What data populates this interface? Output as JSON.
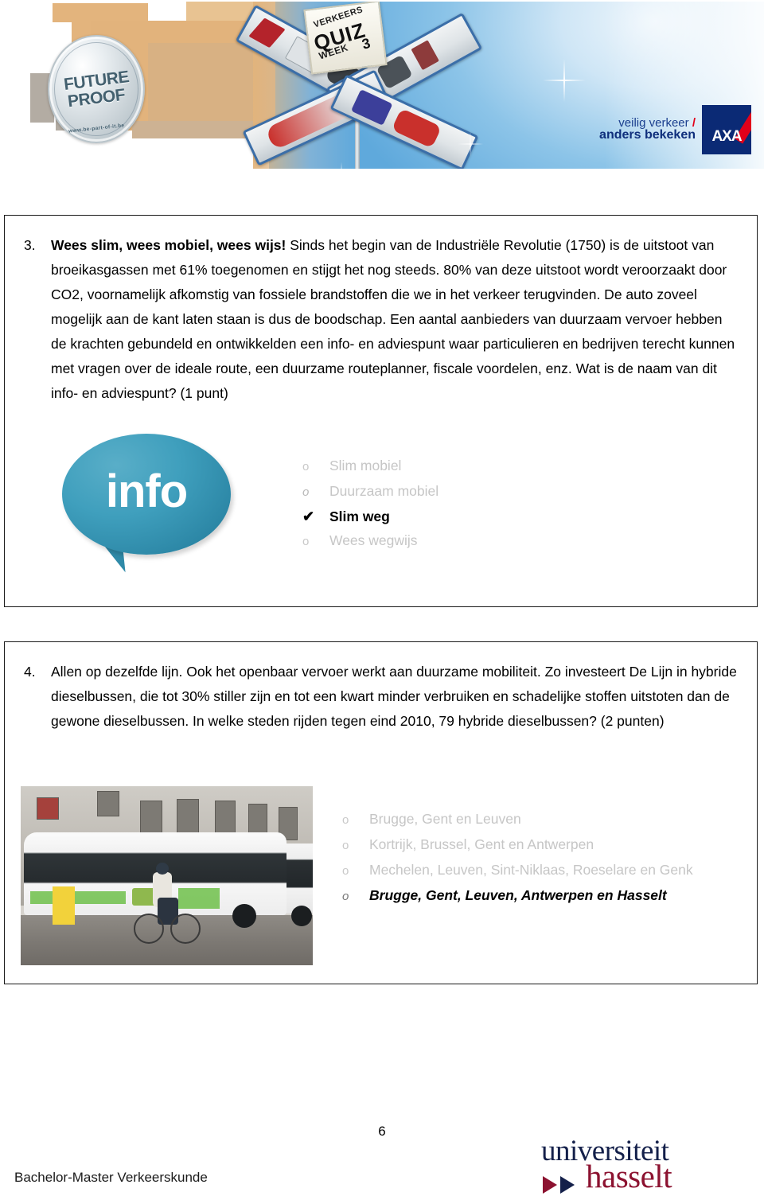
{
  "header": {
    "logo_seal": {
      "line1": "FUTURE",
      "line2": "PROOF",
      "url": "www.be-part-of-it.be"
    },
    "quiz_sign": {
      "line1": "VERKEERS",
      "line2": "QUIZ",
      "line3": "WEEK",
      "line4": "3"
    },
    "sponsor": {
      "tagline_line1": "veilig verkeer",
      "tagline_slash": "/",
      "tagline_line2": "anders bekeken",
      "logo_text": "AXA"
    },
    "colors": {
      "sky": "#8cc4e8",
      "sign_border": "#3b6ea8",
      "tan": "#e2b37c",
      "axa_blue": "#0b2a75",
      "axa_red": "#e2001a"
    }
  },
  "questions": [
    {
      "number": "3.",
      "text": "Wees slim, wees mobiel, wees wijs! Sinds het begin van de Industriële Revolutie (1750) is de uitstoot van broeikasgassen met 61% toegenomen en stijgt het nog steeds. 80% van deze uitstoot wordt veroorzaakt door CO2, voornamelijk afkomstig van fossiele brandstoffen die we in het verkeer terugvinden. De auto zoveel mogelijk aan de kant laten staan is dus de boodschap. Een aantal aanbieders van duurzaam vervoer hebben de krachten gebundeld en ontwikkelden een info- en adviespunt waar particulieren en bedrijven terecht kunnen met vragen over de ideale route, een duurzame routeplanner, fiscale voordelen, enz. Wat is de naam van dit info- en adviespunt? (1 punt)",
      "image_alt": "info-speech-bubble",
      "image_text": "info",
      "options": [
        {
          "marker": "o",
          "label": "Slim mobiel",
          "selected": false
        },
        {
          "marker": "o",
          "label": "Duurzaam mobiel",
          "selected": false
        },
        {
          "marker": "✔",
          "label": "Slim weg",
          "selected": true
        },
        {
          "marker": "o",
          "label": "Wees wegwijs",
          "selected": false
        }
      ]
    },
    {
      "number": "4.",
      "text": "Allen op dezelfde lijn. Ook het openbaar vervoer werkt aan duurzame mobiliteit. Zo investeert De Lijn in hybride dieselbussen, die tot 30% stiller zijn en tot een kwart minder verbruiken en schadelijke stoffen uitstoten dan de gewone dieselbussen. In welke steden rijden tegen eind 2010, 79 hybride dieselbussen? (2 punten)",
      "image_alt": "hybrid-bus-photo",
      "options": [
        {
          "marker": "o",
          "label": "Brugge, Gent en Leuven",
          "selected": false
        },
        {
          "marker": "o",
          "label": "Kortrijk, Brussel, Gent en Antwerpen",
          "selected": false
        },
        {
          "marker": "o",
          "label": "Mechelen, Leuven, Sint-Niklaas, Roeselare en Genk",
          "selected": false
        },
        {
          "marker": "o",
          "label": "Brugge, Gent, Leuven, Antwerpen en Hasselt",
          "selected": true
        }
      ]
    }
  ],
  "footer": {
    "page_number": "6",
    "left_text": "Bachelor-Master Verkeerskunde",
    "university_logo": {
      "word1": "universiteit",
      "word2": "hasselt"
    }
  }
}
